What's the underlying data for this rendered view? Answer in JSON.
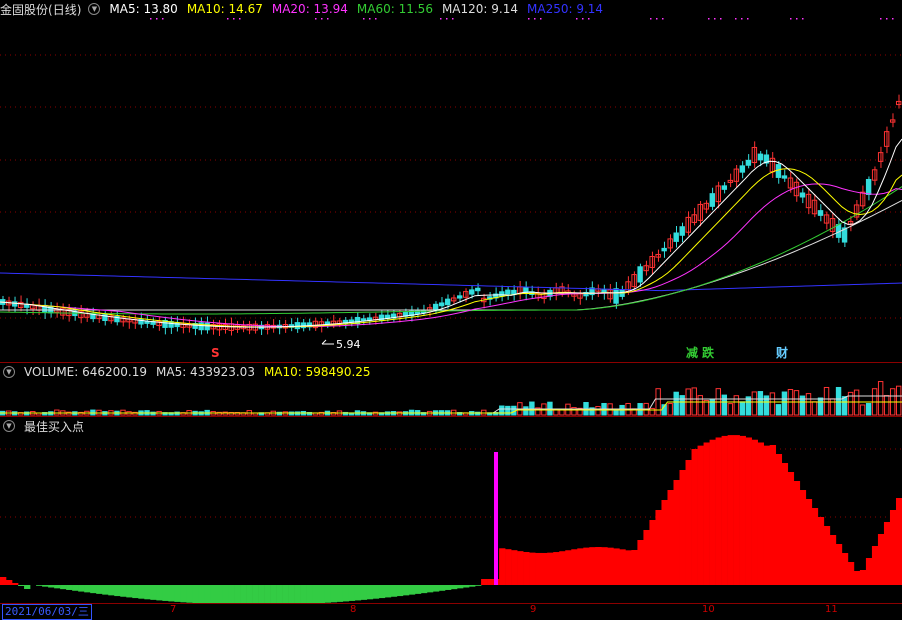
{
  "app": {
    "stock_name": "金固股份",
    "period": "(日线)"
  },
  "main_header": {
    "indicators": [
      {
        "label": "MA5: 13.80",
        "color": "#ffffff"
      },
      {
        "label": "MA10: 14.67",
        "color": "#ffff00"
      },
      {
        "label": "MA20: 13.94",
        "color": "#ff33ff"
      },
      {
        "label": "MA60: 11.56",
        "color": "#33cc33"
      },
      {
        "label": "MA120: 9.14",
        "color": "#dddddd"
      },
      {
        "label": "MA250: 9.14",
        "color": "#3333ff"
      }
    ]
  },
  "price_panel": {
    "low_annotation": "5.94",
    "markers": [
      {
        "text": "S",
        "color": "#ff3333"
      },
      {
        "text": "减",
        "color": "#33cc33"
      },
      {
        "text": "跌",
        "color": "#33cc33"
      },
      {
        "text": "财",
        "color": "#66ccff"
      }
    ]
  },
  "volume_header": {
    "indicators": [
      {
        "label": "VOLUME: 646200.19",
        "color": "#dddddd"
      },
      {
        "label": "MA5: 433923.03",
        "color": "#dddddd"
      },
      {
        "label": "MA10: 598490.25",
        "color": "#ffff00"
      }
    ]
  },
  "signal_header": {
    "title": "最佳买入点"
  },
  "x_axis": {
    "date_label": "2021/06/03/三",
    "ticks": [
      "7",
      "8",
      "9",
      "10",
      "11"
    ]
  },
  "colors": {
    "up": "#ff3333",
    "down": "#33dddd",
    "green_hist": "#33cc44",
    "red_hist": "#ff0000",
    "spike": "#ff00ff",
    "grid": "#8b0000"
  }
}
